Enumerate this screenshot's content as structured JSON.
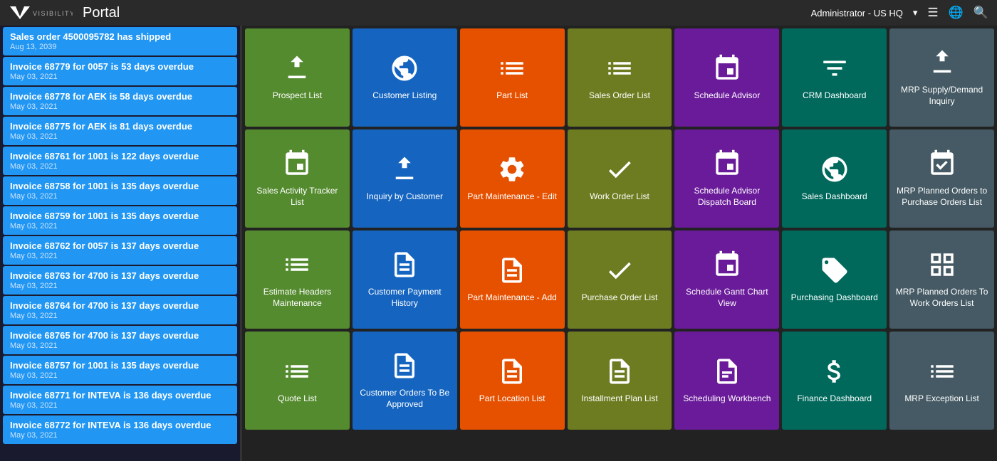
{
  "topnav": {
    "logo_v": "V̈",
    "brand": "VISIBILITY",
    "portal": "Portal",
    "admin": "Administrator - US HQ",
    "admin_dropdown": "▾"
  },
  "sidebar": {
    "items": [
      {
        "title": "Sales order 4500095782 has shipped",
        "date": "Aug 13, 2039"
      },
      {
        "title": "Invoice 68779 for 0057 is 53 days overdue",
        "date": "May 03, 2021"
      },
      {
        "title": "Invoice 68778 for AEK is 58 days overdue",
        "date": "May 03, 2021"
      },
      {
        "title": "Invoice 68775 for AEK is 81 days overdue",
        "date": "May 03, 2021"
      },
      {
        "title": "Invoice 68761 for 1001 is 122 days overdue",
        "date": "May 03, 2021"
      },
      {
        "title": "Invoice 68758 for 1001 is 135 days overdue",
        "date": "May 03, 2021"
      },
      {
        "title": "Invoice 68759 for 1001 is 135 days overdue",
        "date": "May 03, 2021"
      },
      {
        "title": "Invoice 68762 for 0057 is 137 days overdue",
        "date": "May 03, 2021"
      },
      {
        "title": "Invoice 68763 for 4700 is 137 days overdue",
        "date": "May 03, 2021"
      },
      {
        "title": "Invoice 68764 for 4700 is 137 days overdue",
        "date": "May 03, 2021"
      },
      {
        "title": "Invoice 68765 for 4700 is 137 days overdue",
        "date": "May 03, 2021"
      },
      {
        "title": "Invoice 68757 for 1001 is 135 days overdue",
        "date": "May 03, 2021"
      },
      {
        "title": "Invoice 68771 for INTEVA is 136 days overdue",
        "date": "May 03, 2021"
      },
      {
        "title": "Invoice 68772 for INTEVA is 136 days overdue",
        "date": "May 03, 2021"
      }
    ]
  },
  "tiles": [
    {
      "row": 0,
      "col": 0,
      "label": "Prospect List",
      "color": "green",
      "icon": "download-box"
    },
    {
      "row": 0,
      "col": 1,
      "label": "Customer Listing",
      "color": "blue",
      "icon": "globe"
    },
    {
      "row": 0,
      "col": 2,
      "label": "Part List",
      "color": "orange",
      "icon": "list-rows"
    },
    {
      "row": 0,
      "col": 3,
      "label": "Sales Order List",
      "color": "olive",
      "icon": "list-rows"
    },
    {
      "row": 0,
      "col": 4,
      "label": "Schedule Advisor",
      "color": "purple",
      "icon": "calendar"
    },
    {
      "row": 0,
      "col": 5,
      "label": "CRM Dashboard",
      "color": "teal",
      "icon": "funnel"
    },
    {
      "row": 0,
      "col": 6,
      "label": "MRP Supply/Demand Inquiry",
      "color": "dark-gray",
      "icon": "download-box"
    },
    {
      "row": 1,
      "col": 0,
      "label": "Sales Activity Tracker List",
      "color": "green",
      "icon": "calendar-grid"
    },
    {
      "row": 1,
      "col": 1,
      "label": "Inquiry by Customer",
      "color": "blue",
      "icon": "download-box"
    },
    {
      "row": 1,
      "col": 2,
      "label": "Part Maintenance - Edit",
      "color": "orange",
      "icon": "gear"
    },
    {
      "row": 1,
      "col": 3,
      "label": "Work Order List",
      "color": "olive",
      "icon": "checkmark"
    },
    {
      "row": 1,
      "col": 4,
      "label": "Schedule Advisor Dispatch Board",
      "color": "purple",
      "icon": "calendar"
    },
    {
      "row": 1,
      "col": 5,
      "label": "Sales Dashboard",
      "color": "teal",
      "icon": "globe"
    },
    {
      "row": 1,
      "col": 6,
      "label": "MRP Planned Orders to Purchase Orders List",
      "color": "dark-gray",
      "icon": "calendar-check"
    },
    {
      "row": 2,
      "col": 0,
      "label": "Estimate Headers Maintenance",
      "color": "green",
      "icon": "list-rows"
    },
    {
      "row": 2,
      "col": 1,
      "label": "Customer Payment History",
      "color": "blue",
      "icon": "document"
    },
    {
      "row": 2,
      "col": 2,
      "label": "Part Maintenance - Add",
      "color": "orange",
      "icon": "document"
    },
    {
      "row": 2,
      "col": 3,
      "label": "Purchase Order List",
      "color": "olive",
      "icon": "checkmark"
    },
    {
      "row": 2,
      "col": 4,
      "label": "Schedule Gantt Chart View",
      "color": "purple",
      "icon": "calendar"
    },
    {
      "row": 2,
      "col": 5,
      "label": "Purchasing Dashboard",
      "color": "teal",
      "icon": "tag"
    },
    {
      "row": 2,
      "col": 6,
      "label": "MRP Planned Orders To Work Orders List",
      "color": "dark-gray",
      "icon": "grid"
    },
    {
      "row": 3,
      "col": 0,
      "label": "Quote List",
      "color": "green",
      "icon": "list-rows"
    },
    {
      "row": 3,
      "col": 1,
      "label": "Customer Orders To Be Approved",
      "color": "blue",
      "icon": "document"
    },
    {
      "row": 3,
      "col": 2,
      "label": "Part Location List",
      "color": "orange",
      "icon": "document"
    },
    {
      "row": 3,
      "col": 3,
      "label": "Installment Plan List",
      "color": "olive",
      "icon": "document"
    },
    {
      "row": 3,
      "col": 4,
      "label": "Scheduling Workbench",
      "color": "purple",
      "icon": "document-lines"
    },
    {
      "row": 3,
      "col": 5,
      "label": "Finance Dashboard",
      "color": "teal",
      "icon": "money"
    },
    {
      "row": 3,
      "col": 6,
      "label": "MRP Exception List",
      "color": "dark-gray",
      "icon": "list-rows"
    }
  ]
}
